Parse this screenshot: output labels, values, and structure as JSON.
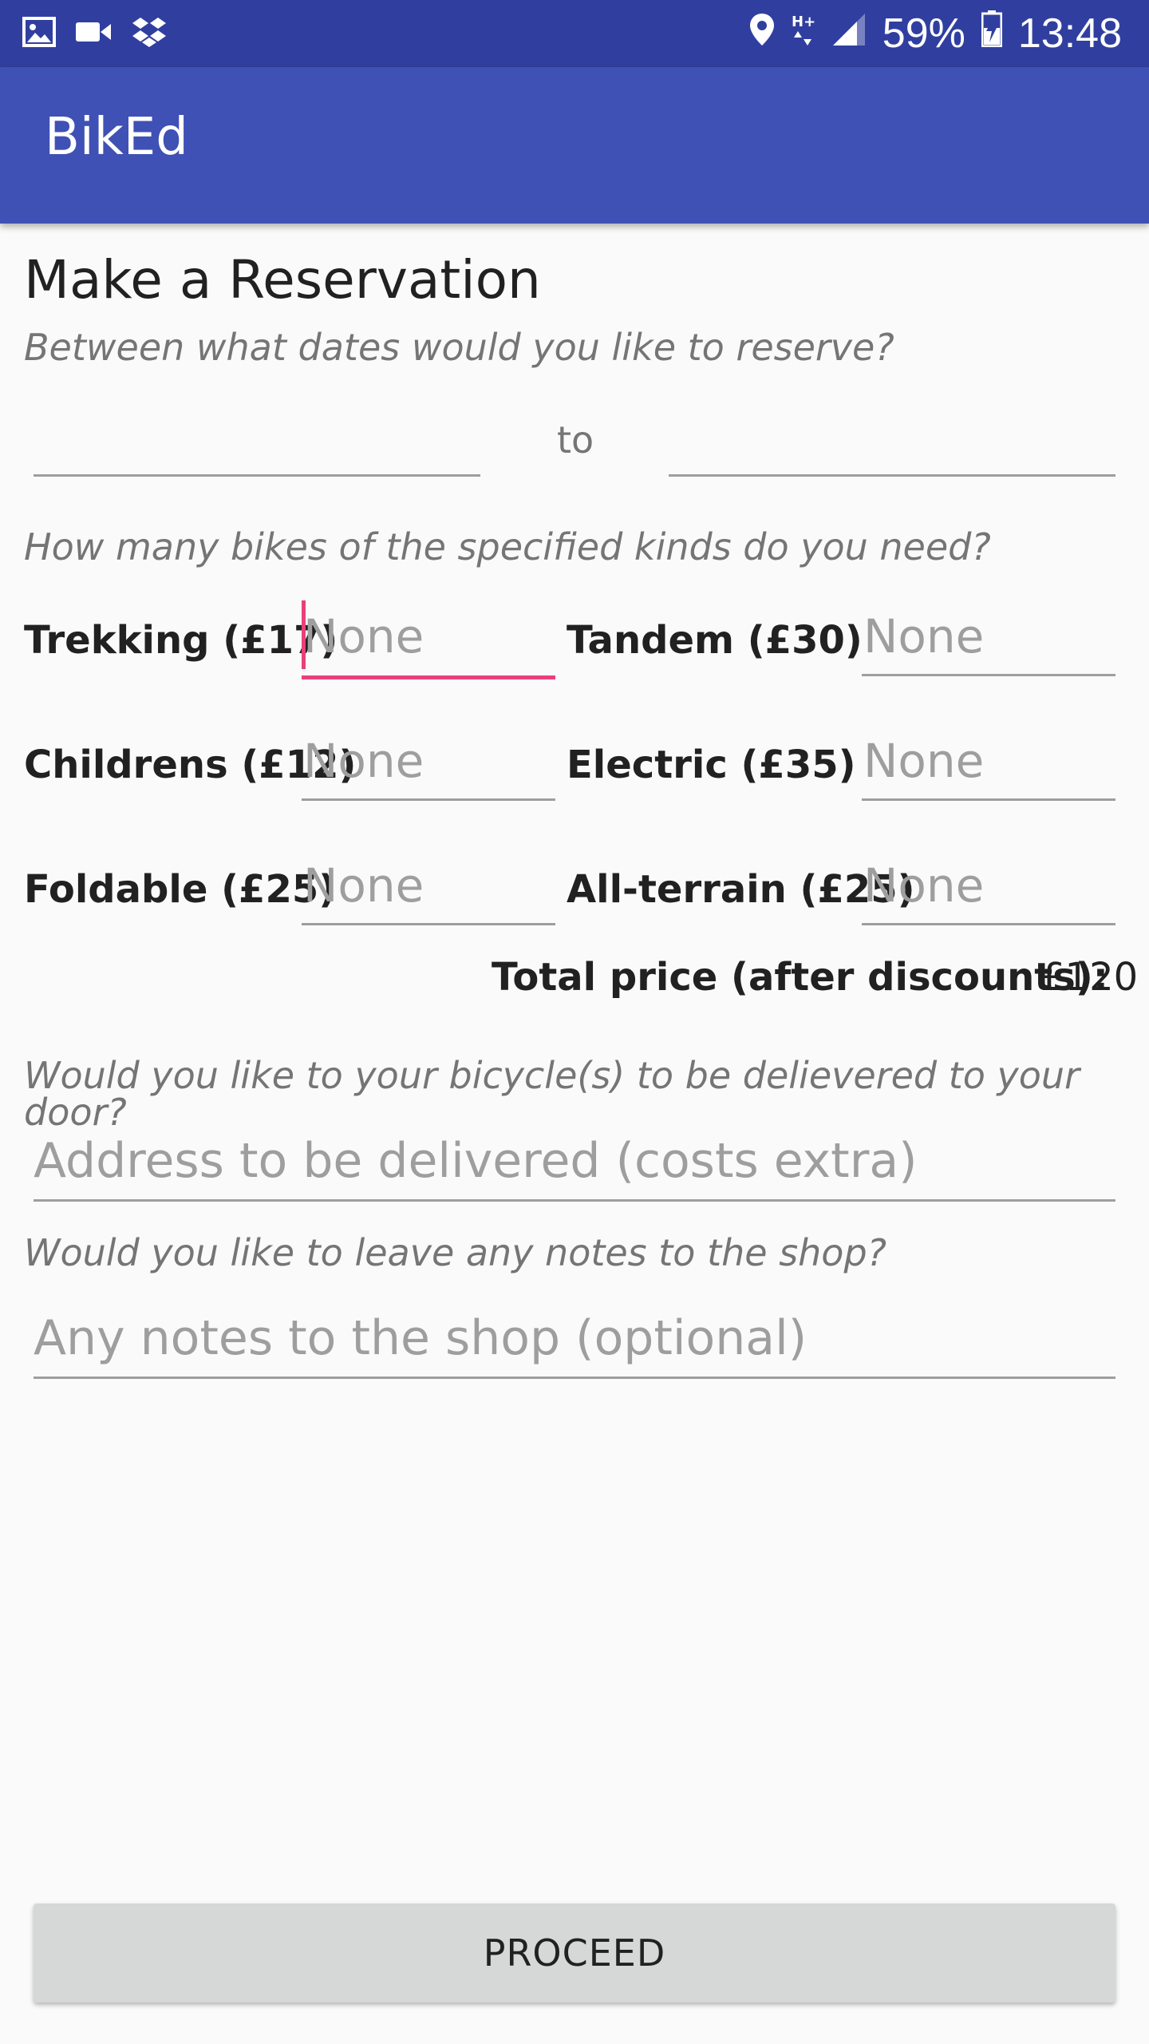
{
  "status_bar": {
    "left_icons": [
      "image-icon",
      "video-camera-icon",
      "dropbox-icon"
    ],
    "right_icons": [
      "location-pin-icon",
      "network-hplus-icon",
      "signal-icon",
      "battery-charging-icon"
    ],
    "battery": "59%",
    "time": "13:48"
  },
  "app_bar": {
    "title": "BikEd"
  },
  "form": {
    "heading": "Make a Reservation",
    "dates_prompt": "Between what dates would you like to reserve?",
    "to_label": "to",
    "bikes_prompt": "How many bikes of the specified kinds do you need?",
    "bikes": [
      {
        "label": "Trekking (£17)",
        "hint": "None"
      },
      {
        "label": "Tandem (£30)",
        "hint": "None"
      },
      {
        "label": "Childrens (£12)",
        "hint": "None"
      },
      {
        "label": "Electric (£35)",
        "hint": "None"
      },
      {
        "label": "Foldable (£25)",
        "hint": "None"
      },
      {
        "label": "All-terrain (£25)",
        "hint": "None"
      }
    ],
    "total_label": "Total price (after discounts):",
    "total_value": "£120",
    "delivery_prompt": "Would you like to your bicycle(s) to be delievered to your door?",
    "address_placeholder": "Address to be delivered (costs extra)",
    "notes_prompt": "Would you like to leave any notes to the shop?",
    "notes_placeholder": "Any notes to the shop (optional)",
    "proceed_label": "PROCEED"
  },
  "colors": {
    "status_bar": "#303f9f",
    "app_bar": "#3f51b5",
    "accent": "#e9407a",
    "hint": "#9e9e9e",
    "button": "#d6d7d7"
  }
}
